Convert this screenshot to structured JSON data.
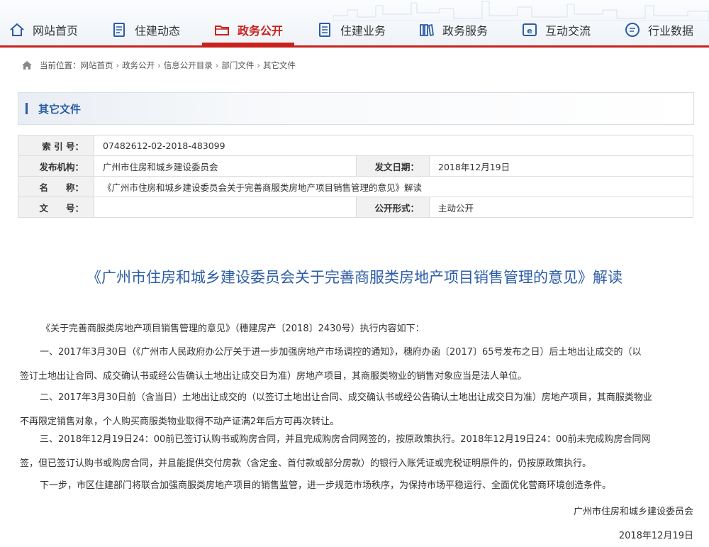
{
  "nav": {
    "items": [
      {
        "label": "网站首页",
        "icon": "home-icon"
      },
      {
        "label": "住建动态",
        "icon": "document-icon"
      },
      {
        "label": "政务公开",
        "icon": "folder-icon",
        "active": true
      },
      {
        "label": "住建业务",
        "icon": "list-document-icon"
      },
      {
        "label": "政务服务",
        "icon": "books-icon"
      },
      {
        "label": "互动交流",
        "icon": "ie-browser-icon"
      },
      {
        "label": "行业数据",
        "icon": "chat-icon"
      }
    ],
    "accent_color": "#c8221d"
  },
  "breadcrumb": {
    "prefix": "当前位置：",
    "items": [
      "网站首页",
      "政务公开",
      "信息公开目录",
      "部门文件",
      "其它文件"
    ],
    "separator": "›"
  },
  "section": {
    "title": "其它文件",
    "accent_color": "#2c5da6"
  },
  "info": {
    "index_label": "索 引 号：",
    "index_value": "07482612-02-2018-483099",
    "org_label": "发布机构：",
    "org_value": "广州市住房和城乡建设委员会",
    "date_label": "发文日期：",
    "date_value": "2018年12月19日",
    "name_label": "名　　称：",
    "name_value": "《广州市住房和城乡建设委员会关于完善商服类房地产项目销售管理的意见》解读",
    "docno_label": "文　　号：",
    "docno_value": "",
    "form_label": "公开形式：",
    "form_value": "主动公开"
  },
  "article": {
    "title": "《广州市住房和城乡建设委员会关于完善商服类房地产项目销售管理的意见》解读",
    "p1": "《关于完善商服类房地产项目销售管理的意见》（穗建房产〔2018〕2430号）执行内容如下：",
    "p2_l1": "一、2017年3月30日（《广州市人民政府办公厅关于进一步加强房地产市场调控的通知》，穗府办函〔2017〕65号发布之日）后土地出让成交的（以",
    "p2_l2": "签订土地出让合同、成交确认书或经公告确认土地出让成交日为准）房地产项目，其商服类物业的销售对象应当是法人单位。",
    "p3_l1": "二、2017年3月30日前（含当日）土地出让成交的（以签订土地出让合同、成交确认书或经公告确认土地出让成交日为准）房地产项目，其商服类物业",
    "p3_l2": "不再限定销售对象，个人购买商服类物业取得不动产证满2年后方可再次转让。",
    "p4_l1": "三、2018年12月19日24：00前已签订认购书或购房合同，并且完成购房合同网签的，按原政策执行。2018年12月19日24：00前未完成购房合同网",
    "p4_l2": "签，但已签订认购书或购房合同，并且能提供交付房款（含定金、首付款或部分房款）的银行入账凭证或完税证明原件的，仍按原政策执行。",
    "p5": "下一步，市区住建部门将联合加强商服类房地产项目的销售监管，进一步规范市场秩序，为保持市场平稳运行、全面优化营商环境创造条件。",
    "signature": "广州市住房和城乡建设委员会",
    "sign_date": "2018年12月19日"
  }
}
